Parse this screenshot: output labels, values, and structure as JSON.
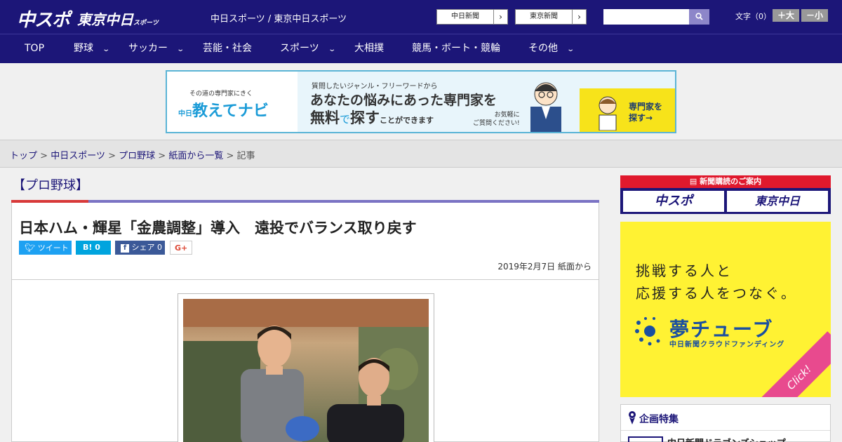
{
  "header": {
    "logo_primary": "中スポ",
    "logo_secondary": "東京中日",
    "logo_secondary_small": "スポーツ",
    "site_names": "中日スポーツ / 東京中日スポーツ",
    "paper_buttons": [
      {
        "label": "中日新聞",
        "arrow": "›"
      },
      {
        "label": "東京新聞",
        "arrow": "›"
      }
    ],
    "search": {
      "placeholder": "",
      "value": ""
    },
    "font_size": {
      "label": "文字（0）",
      "larger": "＋大",
      "smaller": "－小"
    }
  },
  "nav": {
    "items": [
      {
        "label": "TOP",
        "has_dropdown": false
      },
      {
        "label": "野球",
        "has_dropdown": true
      },
      {
        "label": "サッカー",
        "has_dropdown": true
      },
      {
        "label": "芸能・社会",
        "has_dropdown": false
      },
      {
        "label": "スポーツ",
        "has_dropdown": true
      },
      {
        "label": "大相撲",
        "has_dropdown": false
      },
      {
        "label": "競馬・ボート・競輪",
        "has_dropdown": false
      },
      {
        "label": "その他",
        "has_dropdown": true
      }
    ],
    "chevron": "⌄"
  },
  "banner": {
    "small": "その道の専門家にきく",
    "brand_prefix": "中日",
    "brand": "教えてナビ",
    "line1": "質問したいジャンル・フリーワードから",
    "line2": "あなたの悩みにあった専門家を",
    "line3_a": "無料",
    "line3_b": "で",
    "line3_c": "探す",
    "line3_d": "ことができます",
    "small2_a": "お気軽に",
    "small2_b": "ご質問ください!",
    "cta_a": "専門家を",
    "cta_b": "探す→"
  },
  "breadcrumb": {
    "items": [
      "トップ",
      "中日スポーツ",
      "プロ野球",
      "紙面から一覧"
    ],
    "current": "記事",
    "separator": ">"
  },
  "article": {
    "section": "【プロ野球】",
    "headline": "日本ハム・輝星「金農調整」導入　遠投でバランス取り戻す",
    "share": {
      "tweet": "ツイート",
      "hatena": "B! 0",
      "facebook": "シェア 0",
      "gplus": "G+"
    },
    "date": "2019年2月7日 紙面から"
  },
  "sidebar": {
    "subscribe_head": "新聞購読のご案内",
    "subscribe_1": "中スポ",
    "subscribe_2": "東京中日",
    "yume_line1": "挑戦する人と",
    "yume_line2": "応援する人をつなぐ。",
    "yume_brand": "夢チューブ",
    "yume_sub": "中日新聞クラウドファンディング",
    "yume_click": "Click!",
    "feature_title": "企画特集",
    "feature_item": "中日新聞ドラゴンズショップ"
  },
  "colors": {
    "brand_navy": "#1c1678",
    "accent_red": "#e0192d",
    "underline_purple": "#7b73c4",
    "twitter": "#1da1f2",
    "hatena": "#00a4de",
    "facebook": "#3b5998",
    "yume_yellow": "#fff233"
  }
}
